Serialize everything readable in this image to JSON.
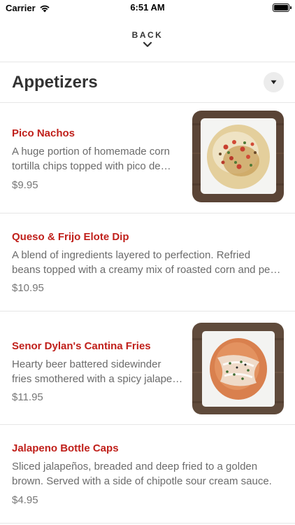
{
  "status_bar": {
    "carrier": "Carrier",
    "time": "6:51 AM",
    "battery_level": 1.0
  },
  "nav": {
    "back_label": "BACK",
    "chevron_icon": "chevron-down-icon"
  },
  "section": {
    "title": "Appetizers",
    "dropdown_icon": "caret-down-icon"
  },
  "items": [
    {
      "name": "Pico Nachos",
      "desc_lines": [
        "A huge portion of homemade corn",
        "tortilla chips topped with pico de…"
      ],
      "price": "$9.95",
      "has_image": true
    },
    {
      "name": "Queso & Frijo Elote Dip",
      "desc_lines": [
        "A blend of ingredients layered to perfection. Refried",
        "beans topped with a creamy mix of roasted corn and pe…"
      ],
      "price": "$10.95",
      "has_image": false
    },
    {
      "name": "Senor Dylan's Cantina Fries",
      "desc_lines": [
        "Hearty beer battered sidewinder",
        "fries smothered with a spicy jalape…"
      ],
      "price": "$11.95",
      "has_image": true
    },
    {
      "name": "Jalapeno Bottle Caps",
      "desc_lines": [
        "Sliced jalapeños, breaded and deep fried to a golden",
        "brown. Served with a side of chipotle sour cream sauce."
      ],
      "price": "$4.95",
      "has_image": false
    }
  ],
  "colors": {
    "item_name": "#c0201b",
    "divider": "#e6e6e6",
    "dropdown_bg": "#ececec"
  }
}
